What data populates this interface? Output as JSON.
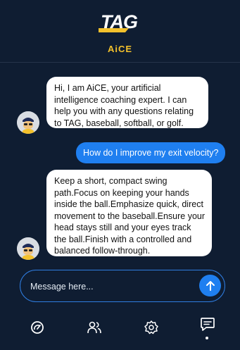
{
  "header": {
    "logo_text": "TAG",
    "subtitle": "AiCE"
  },
  "chat": {
    "messages": [
      {
        "sender": "assistant",
        "text": "Hi, I am AiCE, your artificial intelligence coaching expert. I can help you with any questions relating to TAG, baseball, softball, or golf."
      },
      {
        "sender": "user",
        "text": "How do I improve my exit velocity?"
      },
      {
        "sender": "assistant",
        "text": "Keep a short, compact swing path.Focus on keeping your hands inside the ball.Emphasize quick, direct movement to the baseball.Ensure your head stays still and your eyes track the ball.Finish with a controlled and balanced follow-through."
      }
    ]
  },
  "composer": {
    "placeholder": "Message here..."
  },
  "nav": {
    "items": [
      {
        "icon": "speedometer-icon"
      },
      {
        "icon": "users-icon"
      },
      {
        "icon": "gear-icon"
      },
      {
        "icon": "chat-bubble-icon",
        "active": true
      }
    ]
  },
  "colors": {
    "background": "#0f1d32",
    "accent_blue": "#1f7ff0",
    "accent_yellow": "#f3c12c",
    "bubble_white": "#ffffff"
  }
}
